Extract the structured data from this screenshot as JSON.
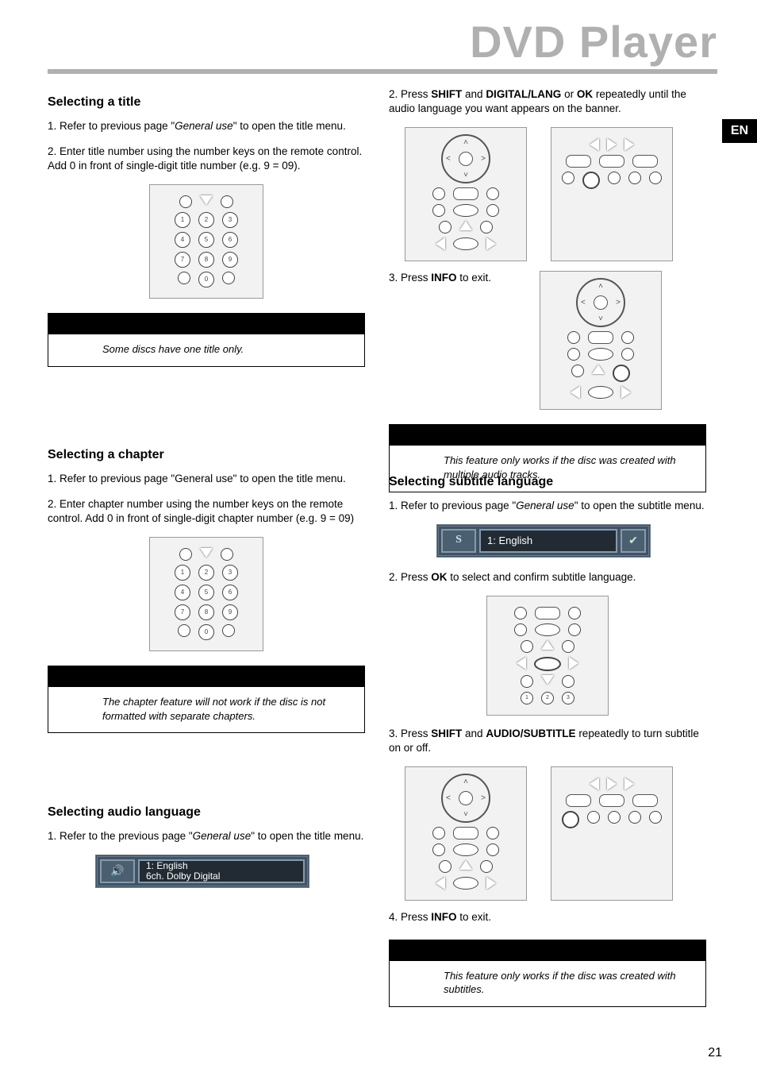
{
  "header": {
    "title": "DVD Player",
    "lang_badge": "EN"
  },
  "page_number": "21",
  "left": {
    "selecting_title": {
      "heading": "Selecting a title",
      "p1_a": "1. Refer to previous page \"",
      "p1_i": "General use",
      "p1_b": "\" to open the title menu.",
      "p2": "2. Enter title number using the number keys on the remote control.  Add 0 in front of single-digit title number (e.g. 9 = 09).",
      "note": "Some discs have one title only."
    },
    "selecting_chapter": {
      "heading": "Selecting a chapter",
      "p1": "1. Refer to previous page \"General use\" to open the title menu.",
      "p2": "2. Enter chapter number using the number keys on the remote control. Add 0 in front of single-digit chapter number (e.g. 9 = 09)",
      "note": "The chapter feature will not work if the disc is not formatted with separate chapters."
    },
    "selecting_audio": {
      "heading": "Selecting audio language",
      "p1_a": "1. Refer to the previous page \"",
      "p1_i": "General use",
      "p1_b": "\" to open the title menu.",
      "osd_line1": "1: English",
      "osd_line2": "6ch. Dolby Digital"
    }
  },
  "right": {
    "audio_cont": {
      "p2_a": "2. Press ",
      "p2_b": "SHIFT",
      "p2_c": " and ",
      "p2_d": "DIGITAL/LANG",
      "p2_e": " or ",
      "p2_f": "OK",
      "p2_g": " repeatedly until the audio language you want appears on the banner.",
      "p3_a": "3.  Press ",
      "p3_b": "INFO",
      "p3_c": " to exit.",
      "note": "This feature only works if the disc was created with multiple audio tracks."
    },
    "selecting_subtitle": {
      "heading": "Selecting subtitle language",
      "p1_a": "1. Refer to previous page \"",
      "p1_i": "General use",
      "p1_b": "\" to open the subtitle menu.",
      "osd_text": "1: English",
      "p2_a": "2. Press ",
      "p2_b": "OK",
      "p2_c": " to select and confirm subtitle language.",
      "p3_a": "3. Press ",
      "p3_b": "SHIFT",
      "p3_c": " and ",
      "p3_d": "AUDIO/SUBTITLE",
      "p3_e": " repeatedly to turn subtitle on or off.",
      "p4_a": "4.  Press ",
      "p4_b": "INFO",
      "p4_c": " to exit.",
      "note": "This feature only works if the disc was created with subtitles."
    }
  },
  "remote_digits": [
    "1",
    "2",
    "3",
    "4",
    "5",
    "6",
    "7",
    "8",
    "9",
    "0"
  ]
}
